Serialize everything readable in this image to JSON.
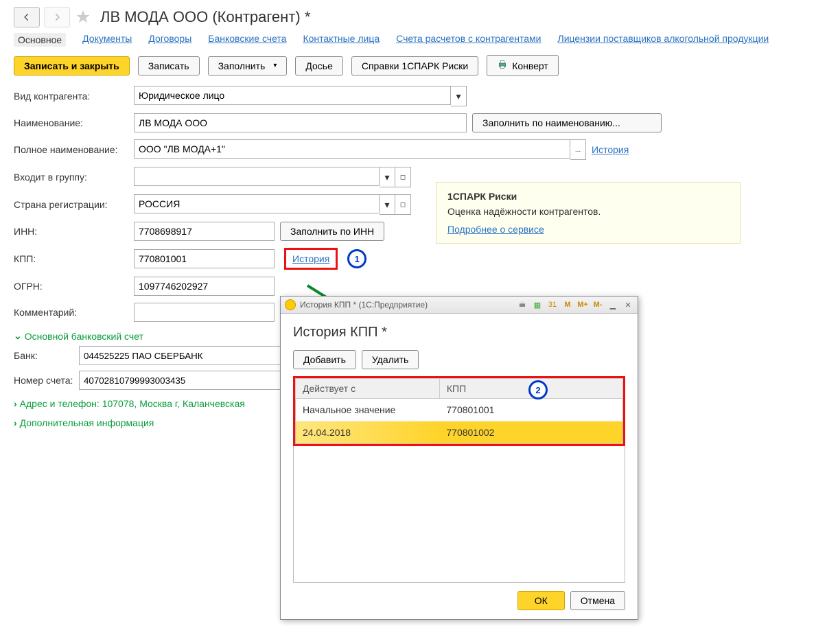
{
  "header": {
    "title": "ЛВ МОДА ООО (Контрагент) *"
  },
  "tabs": {
    "main": "Основное",
    "docs": "Документы",
    "contracts": "Договоры",
    "bank": "Банковские счета",
    "contacts": "Контактные лица",
    "accounts": "Счета расчетов с контрагентами",
    "licenses": "Лицензии поставщиков алкогольной продукции"
  },
  "toolbar": {
    "save_close": "Записать и закрыть",
    "save": "Записать",
    "fill": "Заполнить",
    "dossier": "Досье",
    "spark": "Справки 1СПАРК Риски",
    "envelope": "Конверт"
  },
  "labels": {
    "type": "Вид контрагента:",
    "name": "Наименование:",
    "fullname": "Полное наименование:",
    "group": "Входит в группу:",
    "country": "Страна регистрации:",
    "inn": "ИНН:",
    "kpp": "КПП:",
    "ogrn": "ОГРН:",
    "comment": "Комментарий:",
    "bank_section": "Основной банковский счет",
    "bank": "Банк:",
    "account": "Номер счета:",
    "address_section": "Адрес и телефон: 107078, Москва г, Каланчевская",
    "extra_section": "Дополнительная информация"
  },
  "values": {
    "type": "Юридическое лицо",
    "name": "ЛВ МОДА ООО",
    "fullname": "ООО \"ЛВ МОДА+1\"",
    "group": "",
    "country": "РОССИЯ",
    "inn": "7708698917",
    "kpp": "770801001",
    "ogrn": "1097746202927",
    "comment": "",
    "bank": "044525225 ПАО СБЕРБАНК",
    "account": "40702810799993003435"
  },
  "buttons": {
    "fill_by_name": "Заполнить по наименованию...",
    "history": "История",
    "fill_by_inn": "Заполнить по ИНН",
    "ellipsis": "..."
  },
  "spark_panel": {
    "title": "1СПАРК Риски",
    "text": "Оценка надёжности контрагентов.",
    "link": "Подробнее о сервисе"
  },
  "popup": {
    "window_title": "История КПП * (1С:Предприятие)",
    "m": "M",
    "mplus": "M+",
    "mminus": "M-",
    "heading": "История КПП *",
    "add": "Добавить",
    "delete": "Удалить",
    "col_date": "Действует с",
    "col_kpp": "КПП",
    "rows": [
      {
        "date": "Начальное значение",
        "kpp": "770801001"
      },
      {
        "date": "24.04.2018",
        "kpp": "770801002"
      }
    ],
    "ok": "ОК",
    "cancel": "Отмена"
  },
  "callouts": {
    "one": "1",
    "two": "2"
  }
}
